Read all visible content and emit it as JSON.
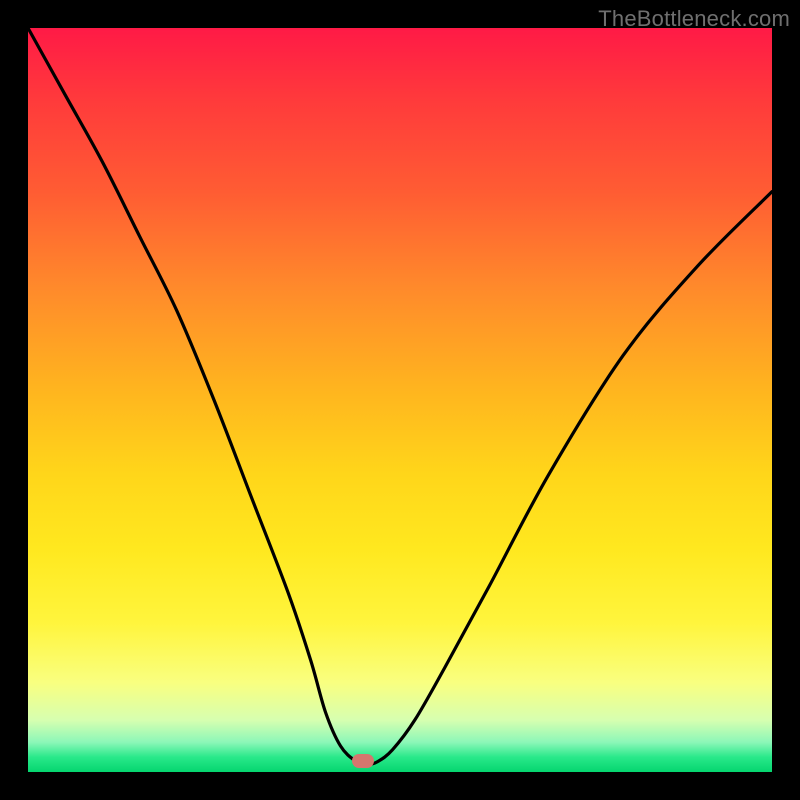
{
  "watermark": "TheBottleneck.com",
  "colors": {
    "page_bg": "#000000",
    "curve": "#000000",
    "marker": "#d5766e"
  },
  "chart_data": {
    "type": "line",
    "title": "",
    "xlabel": "",
    "ylabel": "",
    "xlim": [
      0,
      100
    ],
    "ylim": [
      0,
      100
    ],
    "grid": false,
    "legend": false,
    "curve_points": [
      {
        "x": 0,
        "y": 100
      },
      {
        "x": 5,
        "y": 91
      },
      {
        "x": 10,
        "y": 82
      },
      {
        "x": 15,
        "y": 72
      },
      {
        "x": 20,
        "y": 62
      },
      {
        "x": 25,
        "y": 50
      },
      {
        "x": 30,
        "y": 37
      },
      {
        "x": 35,
        "y": 24
      },
      {
        "x": 38,
        "y": 15
      },
      {
        "x": 40,
        "y": 8
      },
      {
        "x": 42,
        "y": 3.5
      },
      {
        "x": 44,
        "y": 1.5
      },
      {
        "x": 45.5,
        "y": 1.0
      },
      {
        "x": 47,
        "y": 1.4
      },
      {
        "x": 49,
        "y": 3.0
      },
      {
        "x": 52,
        "y": 7
      },
      {
        "x": 56,
        "y": 14
      },
      {
        "x": 62,
        "y": 25
      },
      {
        "x": 70,
        "y": 40
      },
      {
        "x": 80,
        "y": 56
      },
      {
        "x": 90,
        "y": 68
      },
      {
        "x": 100,
        "y": 78
      }
    ],
    "minimum": {
      "x": 45.5,
      "y": 1.0
    },
    "marker": {
      "x": 45,
      "y": 1.5
    }
  }
}
